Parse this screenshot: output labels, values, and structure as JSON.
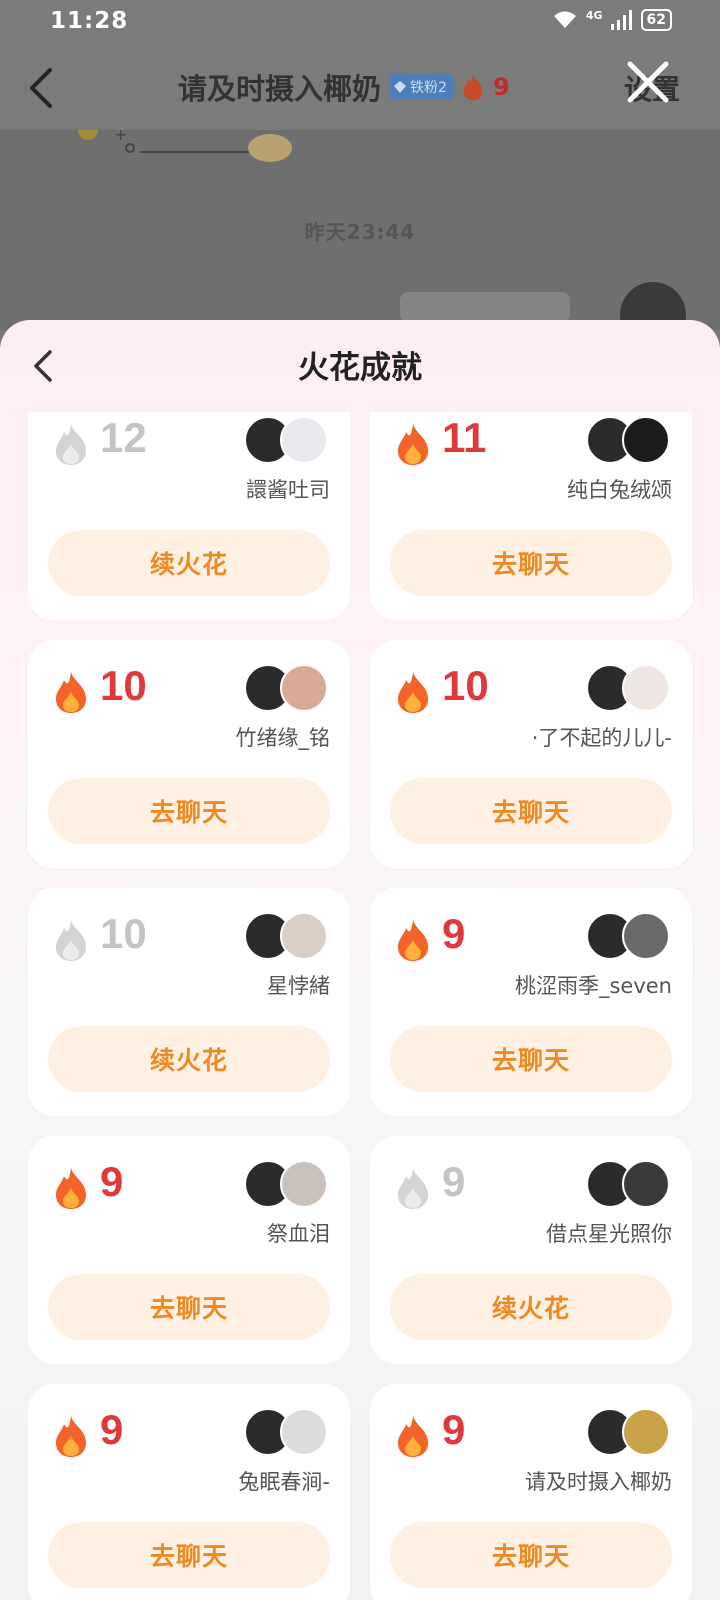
{
  "status_bar": {
    "time": "11:28",
    "network": "4G",
    "battery": "62"
  },
  "chat": {
    "title": "请及时摄入椰奶",
    "badge": "铁粉2",
    "spark_count": "9",
    "settings_label": "设置",
    "timestamp": "昨天23:44"
  },
  "sheet": {
    "title": "火花成就"
  },
  "colors": {
    "flame_active": "#f3632a",
    "flame_inactive": "#d4d4d4",
    "score_active": "#e0393b",
    "button_text": "#ee8a24",
    "button_bg": "#fef0e3"
  },
  "friends": [
    {
      "score": "12",
      "active": false,
      "name": "譞酱吐司",
      "action": "续火花",
      "avatar_color": "#e9e9ee"
    },
    {
      "score": "11",
      "active": true,
      "name": "纯白兔绒颂",
      "action": "去聊天",
      "avatar_color": "#1c1c1c"
    },
    {
      "score": "10",
      "active": true,
      "name": "竹绪缘_铭",
      "action": "去聊天",
      "avatar_color": "#d9a99b"
    },
    {
      "score": "10",
      "active": true,
      "name": "·了不起的儿儿-",
      "action": "去聊天",
      "avatar_color": "#efe7e4"
    },
    {
      "score": "10",
      "active": false,
      "name": "星悖緒",
      "action": "续火花",
      "avatar_color": "#d8cfc5"
    },
    {
      "score": "9",
      "active": true,
      "name": "桃涩雨季_seven",
      "action": "去聊天",
      "avatar_color": "#6b6a68"
    },
    {
      "score": "9",
      "active": true,
      "name": "祭血泪",
      "action": "去聊天",
      "avatar_color": "#c9c1bc"
    },
    {
      "score": "9",
      "active": false,
      "name": "借点星光照你",
      "action": "续火花",
      "avatar_color": "#3a3a3a"
    },
    {
      "score": "9",
      "active": true,
      "name": "兔眠春涧-",
      "action": "去聊天",
      "avatar_color": "#dcdcdc"
    },
    {
      "score": "9",
      "active": true,
      "name": "请及时摄入椰奶",
      "action": "去聊天",
      "avatar_color": "#c9a24a"
    }
  ]
}
